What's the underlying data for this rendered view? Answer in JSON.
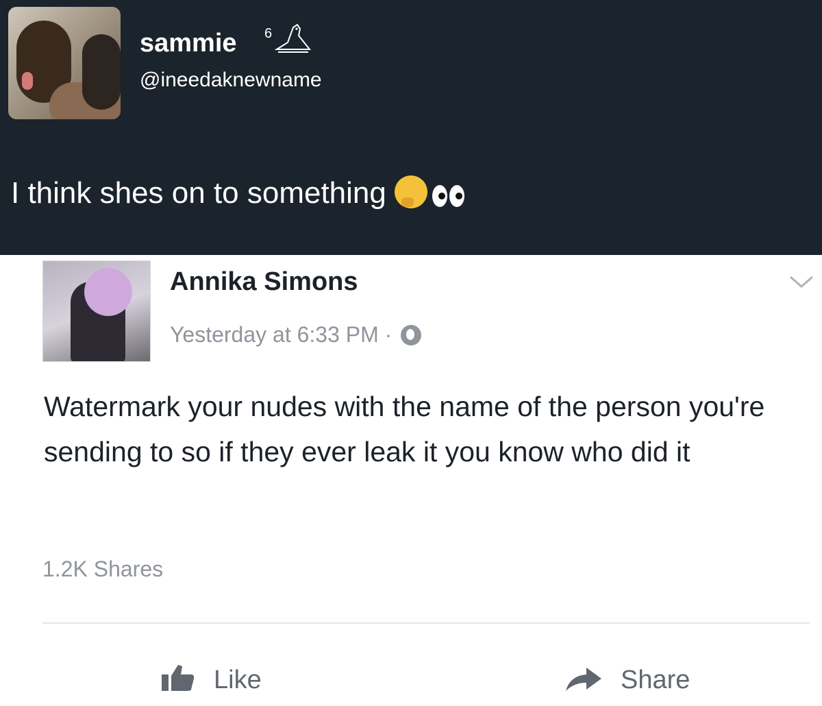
{
  "tweet": {
    "display_name": "sammie",
    "badge": "6",
    "badge_icon": "owl-icon",
    "handle": "@ineedaknewname",
    "text": "I think shes on to something",
    "emojis": [
      "thinking-face-icon",
      "eyes-icon"
    ],
    "background": "#1b232c"
  },
  "facebook_post": {
    "author": "Annika Simons",
    "timestamp": "Yesterday at 6:33 PM ·",
    "privacy_icon": "globe-icon",
    "body": "Watermark your nudes with the name of the person you're sending to so if they ever leak it you know who did it",
    "shares": "1.2K Shares",
    "actions": {
      "like_label": "Like",
      "share_label": "Share"
    },
    "text_color": "#1d2129",
    "meta_color": "#90949c"
  }
}
